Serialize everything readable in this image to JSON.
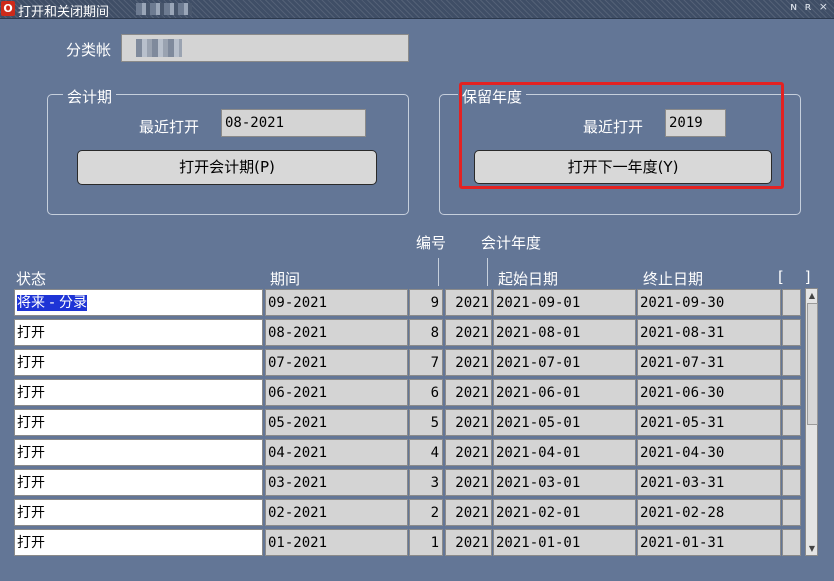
{
  "window": {
    "icon": "oracle-icon",
    "title": "打开和关闭期间",
    "controls": "ɴ ʀ ×"
  },
  "ledger": {
    "label": "分类帐"
  },
  "accounting_period": {
    "legend": "会计期",
    "latest_open_label": "最近打开",
    "latest_open_value": "08-2021",
    "open_button": "打开会计期(P)"
  },
  "retained_year": {
    "legend": "保留年度",
    "latest_open_label": "最近打开",
    "latest_open_value": "2019",
    "open_next_button": "打开下一年度(Y)"
  },
  "table": {
    "group_headers": {
      "number": "编号",
      "fiscal_year": "会计年度"
    },
    "headers": {
      "status": "状态",
      "period": "期间",
      "start_date": "起始日期",
      "end_date": "终止日期",
      "flag": "[ ]"
    },
    "rows": [
      {
        "status": "将来 - 分录",
        "period": "09-2021",
        "num": "9",
        "year": "2021",
        "start": "2021-09-01",
        "end": "2021-09-30"
      },
      {
        "status": "打开",
        "period": "08-2021",
        "num": "8",
        "year": "2021",
        "start": "2021-08-01",
        "end": "2021-08-31"
      },
      {
        "status": "打开",
        "period": "07-2021",
        "num": "7",
        "year": "2021",
        "start": "2021-07-01",
        "end": "2021-07-31"
      },
      {
        "status": "打开",
        "period": "06-2021",
        "num": "6",
        "year": "2021",
        "start": "2021-06-01",
        "end": "2021-06-30"
      },
      {
        "status": "打开",
        "period": "05-2021",
        "num": "5",
        "year": "2021",
        "start": "2021-05-01",
        "end": "2021-05-31"
      },
      {
        "status": "打开",
        "period": "04-2021",
        "num": "4",
        "year": "2021",
        "start": "2021-04-01",
        "end": "2021-04-30"
      },
      {
        "status": "打开",
        "period": "03-2021",
        "num": "3",
        "year": "2021",
        "start": "2021-03-01",
        "end": "2021-03-31"
      },
      {
        "status": "打开",
        "period": "02-2021",
        "num": "2",
        "year": "2021",
        "start": "2021-02-01",
        "end": "2021-02-28"
      },
      {
        "status": "打开",
        "period": "01-2021",
        "num": "1",
        "year": "2021",
        "start": "2021-01-01",
        "end": "2021-01-31"
      }
    ]
  },
  "colors": {
    "background": "#637696",
    "highlight": "#e32222",
    "selection": "#1e34d6"
  }
}
